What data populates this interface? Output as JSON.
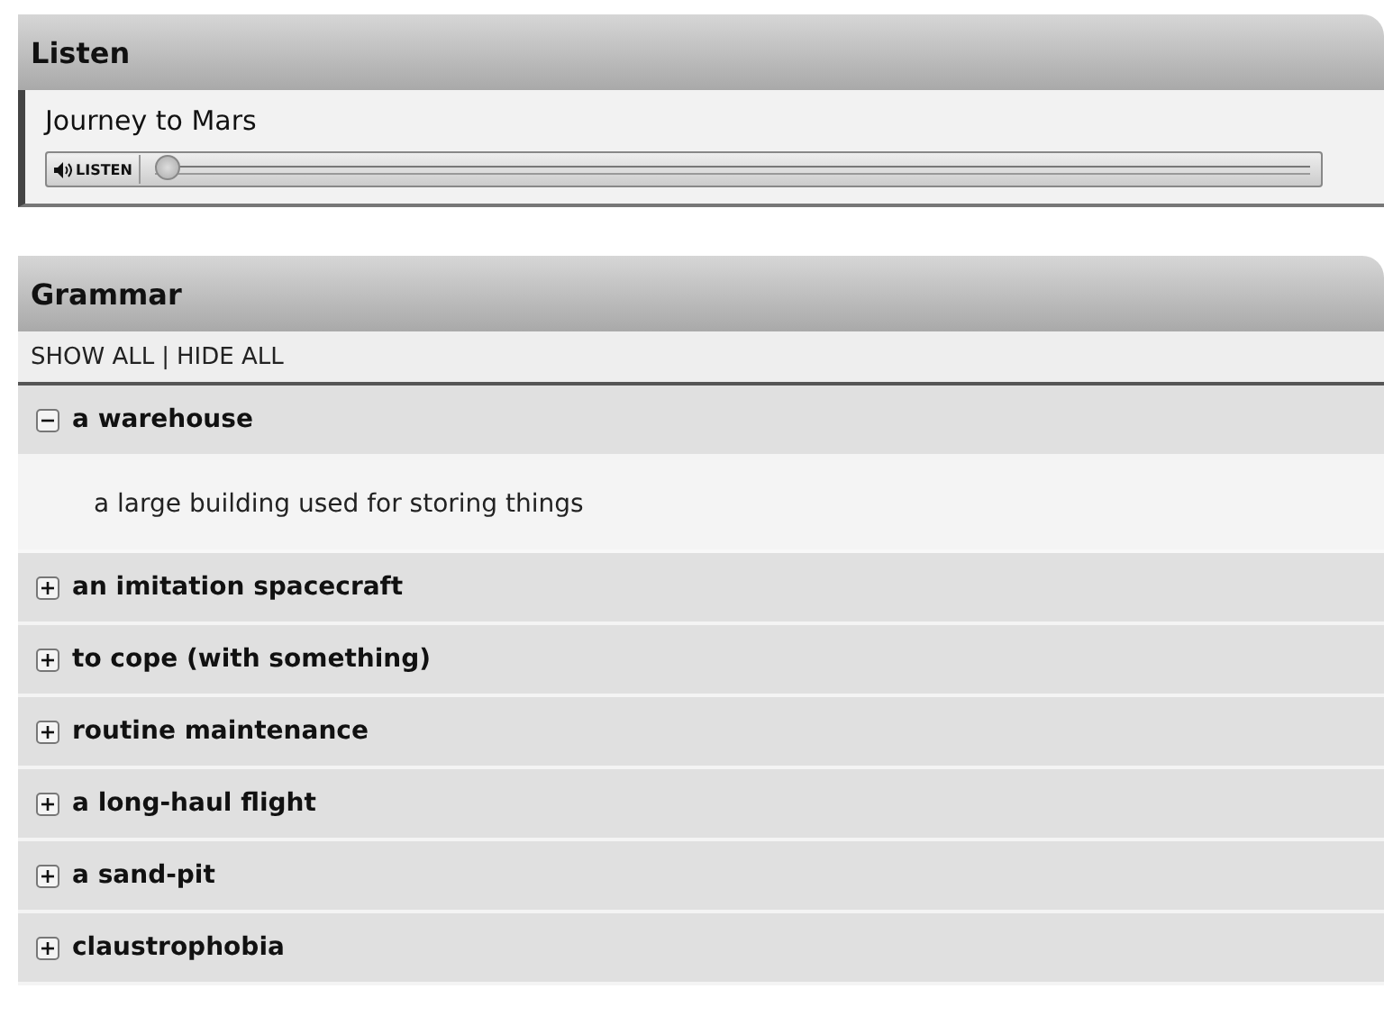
{
  "listen": {
    "title": "Listen",
    "track": "Journey to Mars",
    "player": {
      "label": "LISTEN",
      "level": 0
    }
  },
  "grammar": {
    "title": "Grammar",
    "links": [
      "SHOW ALL",
      "HIDE ALL"
    ],
    "separator": "|",
    "items": [
      {
        "term": "a warehouse",
        "expanded": true,
        "definition": "a large building used for storing things"
      },
      {
        "term": "an imitation spacecraft",
        "expanded": false
      },
      {
        "term": "to cope (with something)",
        "expanded": false
      },
      {
        "term": "routine maintenance",
        "expanded": false
      },
      {
        "term": "a long-haul flight",
        "expanded": false
      },
      {
        "term": "a sand-pit",
        "expanded": false
      },
      {
        "term": "claustrophobia",
        "expanded": false
      }
    ]
  }
}
